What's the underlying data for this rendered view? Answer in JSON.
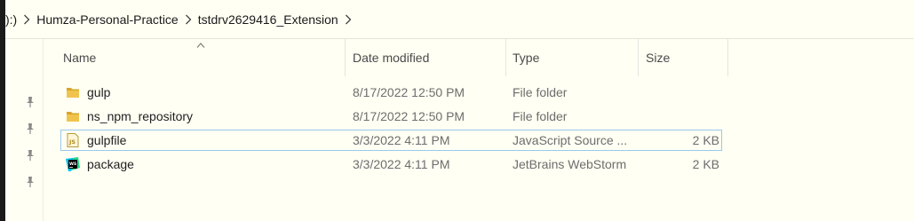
{
  "breadcrumb": {
    "items": [
      "):)",
      "Humza-Personal-Practice",
      "tstdrv2629416_Extension"
    ]
  },
  "columns": {
    "name": "Name",
    "date": "Date modified",
    "type": "Type",
    "size": "Size"
  },
  "files": [
    {
      "name": "gulp",
      "date": "8/17/2022 12:50 PM",
      "type": "File folder",
      "size": "",
      "icon": "folder-icon"
    },
    {
      "name": "ns_npm_repository",
      "date": "8/17/2022 12:50 PM",
      "type": "File folder",
      "size": "",
      "icon": "folder-icon"
    },
    {
      "name": "gulpfile",
      "date": "3/3/2022 4:11 PM",
      "type": "JavaScript Source ...",
      "size": "2 KB",
      "icon": "javascript-file-icon"
    },
    {
      "name": "package",
      "date": "3/3/2022 4:11 PM",
      "type": "JetBrains WebStorm",
      "size": "2 KB",
      "icon": "webstorm-file-icon"
    }
  ],
  "colors": {
    "background": "#fffff3",
    "folder": "#e8b838",
    "selection_border": "#99c9ef"
  }
}
